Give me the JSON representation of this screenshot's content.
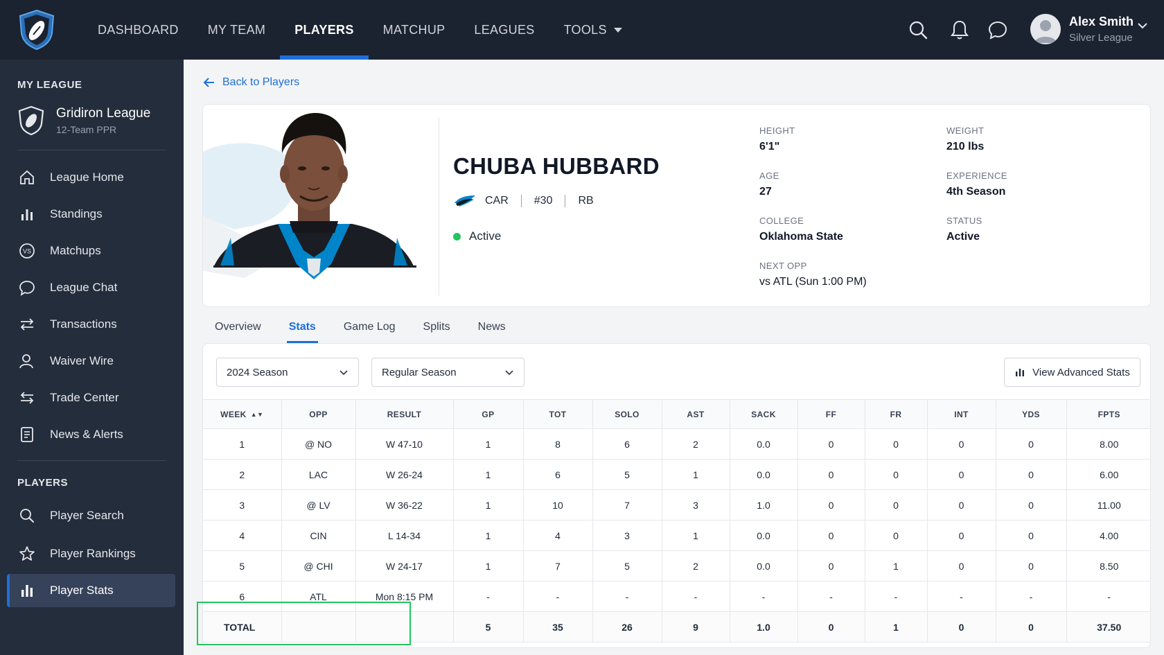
{
  "nav": {
    "items": [
      {
        "label": "DASHBOARD",
        "active": false
      },
      {
        "label": "MY TEAM",
        "active": false
      },
      {
        "label": "PLAYERS",
        "active": true
      },
      {
        "label": "MATCHUP",
        "active": false
      },
      {
        "label": "LEAGUES",
        "active": false
      },
      {
        "label": "TOOLS",
        "active": false,
        "dropdown": true
      }
    ],
    "icons": [
      "search-icon",
      "bell-icon",
      "chat-bubble-icon"
    ],
    "user": {
      "name": "Alex Smith",
      "league": "Silver League"
    }
  },
  "sidebar": {
    "my_league_title": "MY LEAGUE",
    "league": {
      "name": "Gridiron League",
      "sub": "12-Team PPR"
    },
    "league_items": [
      {
        "label": "League Home",
        "icon": "home-icon"
      },
      {
        "label": "Standings",
        "icon": "bar-chart-icon"
      },
      {
        "label": "Matchups",
        "icon": "vs-icon"
      },
      {
        "label": "League Chat",
        "icon": "chat-icon"
      },
      {
        "label": "Transactions",
        "icon": "transfer-icon"
      },
      {
        "label": "Waiver Wire",
        "icon": "user-icon"
      },
      {
        "label": "Trade Center",
        "icon": "trade-icon"
      },
      {
        "label": "News & Alerts",
        "icon": "news-icon"
      }
    ],
    "players_title": "PLAYERS",
    "player_items": [
      {
        "label": "Player Search",
        "icon": "search-icon"
      },
      {
        "label": "Player Rankings",
        "icon": "star-icon"
      },
      {
        "label": "Player Stats",
        "icon": "bar-chart-icon",
        "active": true
      }
    ]
  },
  "back_link": "Back to Players",
  "player": {
    "name": "CHUBA HUBBARD",
    "team": "CAR",
    "number": "#30",
    "position": "RB",
    "status": "Active",
    "attributes": {
      "height": {
        "label": "HEIGHT",
        "value": "6'1\""
      },
      "weight": {
        "label": "WEIGHT",
        "value": "210 lbs"
      },
      "age": {
        "label": "AGE",
        "value": "27"
      },
      "experience": {
        "label": "EXPERIENCE",
        "value": "4th Season"
      },
      "college": {
        "label": "COLLEGE",
        "value": "Oklahoma State"
      },
      "status": {
        "label": "STATUS",
        "value": "Active"
      },
      "next_opp": {
        "label": "NEXT OPP",
        "value": "vs ATL (Sun 1:00 PM)"
      }
    },
    "accent_color": "#0085ca"
  },
  "tabs": [
    "Overview",
    "Stats",
    "Game Log",
    "Splits",
    "News"
  ],
  "active_tab": "Stats",
  "filters": {
    "season": "2024 Season",
    "type": "Regular Season",
    "advanced_button": "View Advanced Stats"
  },
  "table": {
    "headers": [
      "WEEK",
      "OPP",
      "RESULT",
      "GP",
      "TOT",
      "SOLO",
      "AST",
      "SACK",
      "FF",
      "FR",
      "INT",
      "YDS",
      "FPTS"
    ],
    "rows": [
      [
        "1",
        "@ NO",
        "W 47-10",
        "1",
        "8",
        "6",
        "2",
        "0.0",
        "0",
        "0",
        "0",
        "0",
        "8.00"
      ],
      [
        "2",
        "LAC",
        "W 26-24",
        "1",
        "6",
        "5",
        "1",
        "0.0",
        "0",
        "0",
        "0",
        "0",
        "6.00"
      ],
      [
        "3",
        "@ LV",
        "W 36-22",
        "1",
        "10",
        "7",
        "3",
        "1.0",
        "0",
        "0",
        "0",
        "0",
        "11.00"
      ],
      [
        "4",
        "CIN",
        "L 14-34",
        "1",
        "4",
        "3",
        "1",
        "0.0",
        "0",
        "0",
        "0",
        "0",
        "4.00"
      ],
      [
        "5",
        "@ CHI",
        "W 24-17",
        "1",
        "7",
        "5",
        "2",
        "0.0",
        "0",
        "1",
        "0",
        "0",
        "8.50"
      ],
      [
        "6",
        "ATL",
        "Mon 8:15 PM",
        "-",
        "-",
        "-",
        "-",
        "-",
        "-",
        "-",
        "-",
        "-",
        "-"
      ]
    ],
    "total": [
      "TOTAL",
      "",
      "",
      "5",
      "35",
      "26",
      "9",
      "1.0",
      "0",
      "1",
      "0",
      "0",
      "37.50"
    ]
  },
  "colors": {
    "nav_bg": "#1b2230",
    "sidebar_bg": "#242d3b",
    "accent": "#1d6fd8",
    "active_dot": "#22c55e",
    "highlight": "#22c55e"
  }
}
